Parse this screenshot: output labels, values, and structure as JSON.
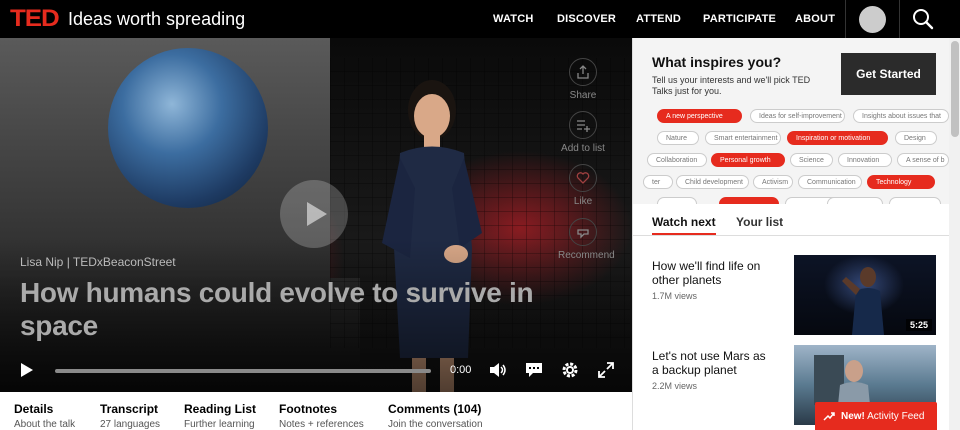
{
  "header": {
    "logo": "TED",
    "tagline": "Ideas worth spreading",
    "nav": [
      "WATCH",
      "DISCOVER",
      "ATTEND",
      "PARTICIPATE",
      "ABOUT"
    ]
  },
  "video": {
    "speaker_event": "Lisa Nip | TEDxBeaconStreet",
    "title": "How humans could evolve to survive in space",
    "time": "0:00",
    "progress": 0,
    "actions": [
      "Share",
      "Add to list",
      "Like",
      "Recommend"
    ]
  },
  "tabs": [
    {
      "title": "Details",
      "sub": "About the talk"
    },
    {
      "title": "Transcript",
      "sub": "27 languages"
    },
    {
      "title": "Reading List",
      "sub": "Further learning"
    },
    {
      "title": "Footnotes",
      "sub": "Notes + references"
    },
    {
      "title": "Comments (104)",
      "sub": "Join the conversation"
    }
  ],
  "inspire": {
    "title": "What inspires you?",
    "description": "Tell us your interests and we'll pick TED Talks just for you.",
    "cta": "Get Started",
    "chips": [
      {
        "label": "A new perspective",
        "selected": true
      },
      {
        "label": "Ideas for self-improvement",
        "selected": false
      },
      {
        "label": "Insights about issues that",
        "selected": false
      },
      {
        "label": "Nature",
        "selected": false
      },
      {
        "label": "Smart entertainment",
        "selected": false
      },
      {
        "label": "Inspiration or motivation",
        "selected": true
      },
      {
        "label": "Design",
        "selected": false
      },
      {
        "label": "Collaboration",
        "selected": false
      },
      {
        "label": "Personal growth",
        "selected": true
      },
      {
        "label": "Science",
        "selected": false
      },
      {
        "label": "Innovation",
        "selected": false
      },
      {
        "label": "A sense of b",
        "selected": false
      },
      {
        "label": "ter",
        "selected": false
      },
      {
        "label": "Child development",
        "selected": false
      },
      {
        "label": "Activism",
        "selected": false
      },
      {
        "label": "Communication",
        "selected": false
      },
      {
        "label": "Technology",
        "selected": true
      }
    ]
  },
  "watch": {
    "tabs": [
      "Watch next",
      "Your list"
    ],
    "talks": [
      {
        "title": "How we'll find life on other planets",
        "views": "1.7M views",
        "duration": "5:25"
      },
      {
        "title": "Let's not use Mars as a backup planet",
        "views": "2.2M views",
        "duration": ""
      }
    ]
  },
  "activity_feed": {
    "badge": "New!",
    "label": "Activity Feed"
  },
  "colors": {
    "brand_red": "#e62b1e",
    "header_bg": "#000000"
  }
}
